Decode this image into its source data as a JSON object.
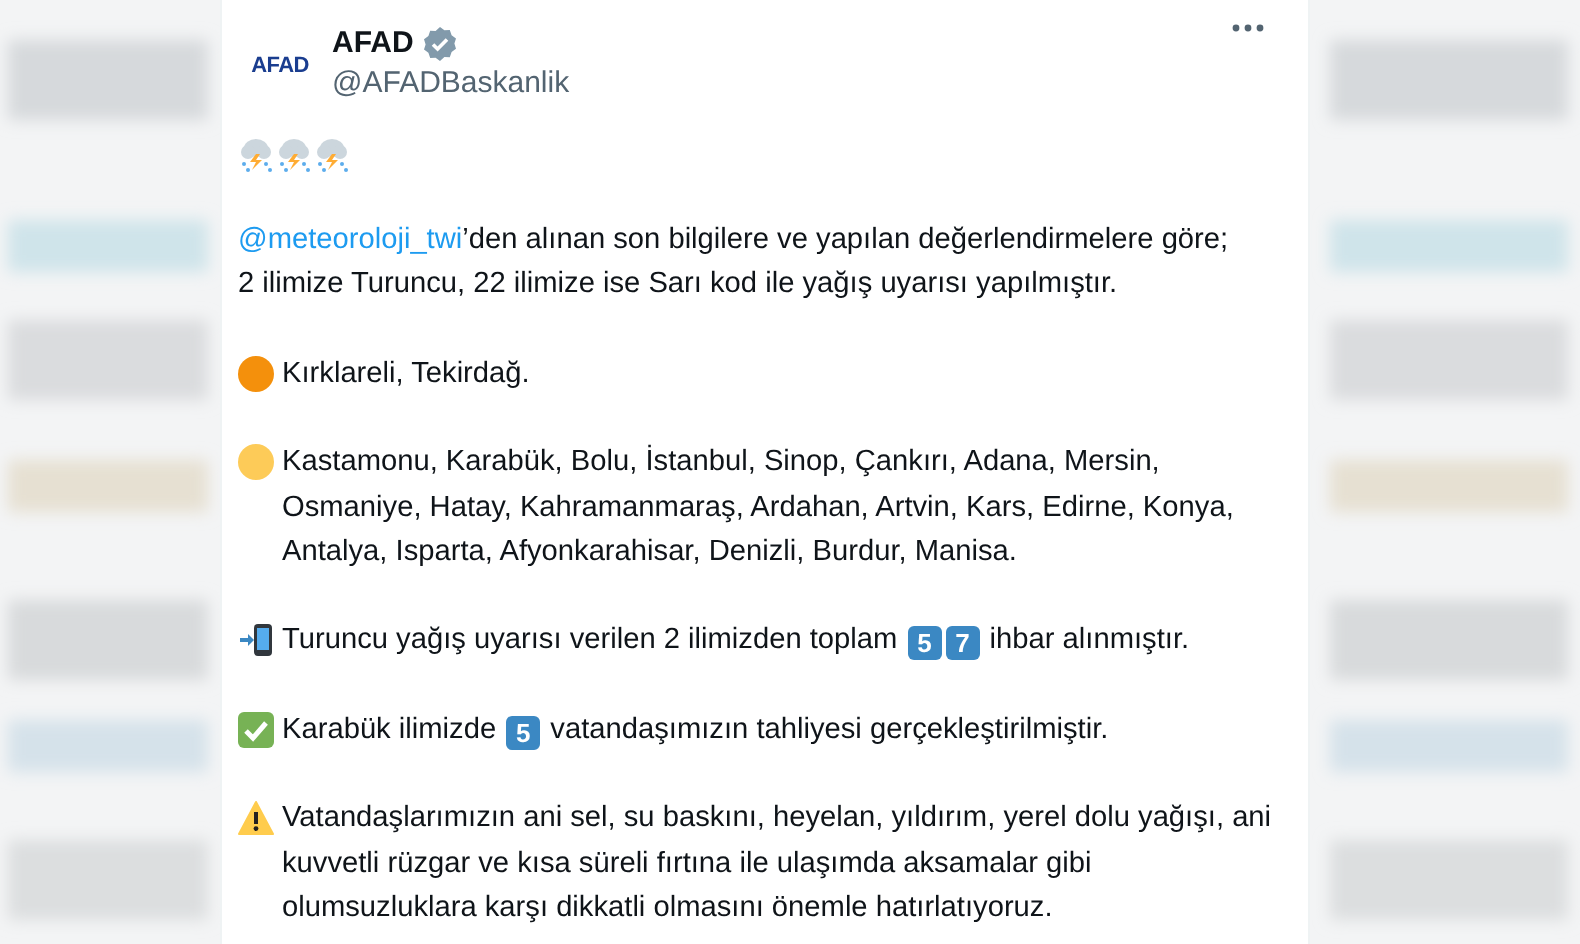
{
  "author": {
    "logo_text": "AFAD",
    "name": "AFAD",
    "handle": "@AFADBaskanlik"
  },
  "paragraphs": [
    {
      "kind": "text",
      "segments": [
        {
          "kind": "link",
          "text": "@meteoroloji_twi"
        },
        {
          "kind": "text",
          "text": "’den alınan son bilgilere ve yapılan değerlendirmelere göre; 2 ilimize Turuncu, 22 ilimize ise Sarı kod ile yağış uyarısı yapılmıştır."
        }
      ]
    },
    {
      "kind": "dot",
      "color": "#f4900c",
      "segments": [
        {
          "kind": "text",
          "text": "Kırklareli, Tekirdağ."
        }
      ]
    },
    {
      "kind": "dot",
      "color": "#fdcb58",
      "segments": [
        {
          "kind": "text",
          "text": "Kastamonu, Karabük, Bolu, İstanbul, Sinop, Çankırı, Adana, Mersin, Osmaniye, Hatay, Kahramanmaraş, Ardahan, Artvin, Kars, Edirne, Konya, Antalya, Isparta, Afyonkarahisar, Denizli, Burdur, Manisa."
        }
      ]
    },
    {
      "kind": "phone",
      "segments": [
        {
          "kind": "text",
          "text": "Turuncu yağış uyarısı verilen 2 ilimizden toplam "
        },
        {
          "kind": "keycap",
          "text": "5"
        },
        {
          "kind": "keycap",
          "text": "7"
        },
        {
          "kind": "text",
          "text": " ihbar alınmıştır."
        }
      ]
    },
    {
      "kind": "check",
      "segments": [
        {
          "kind": "text",
          "text": "Karabük ilimizde "
        },
        {
          "kind": "keycap",
          "text": "5"
        },
        {
          "kind": "text",
          "text": " vatandaşımızın tahliyesi gerçekleştirilmiştir."
        }
      ]
    },
    {
      "kind": "warning",
      "segments": [
        {
          "kind": "text",
          "text": "Vatandaşlarımızın ani sel, su baskını, heyelan, yıldırım, yerel dolu yağışı, ani kuvvetli rüzgar ve kısa süreli fırtına ile ulaşımda aksamalar gibi olumsuzluklara karşı dikkatli olmasını önemle hatırlatıyoruz."
        }
      ]
    }
  ]
}
